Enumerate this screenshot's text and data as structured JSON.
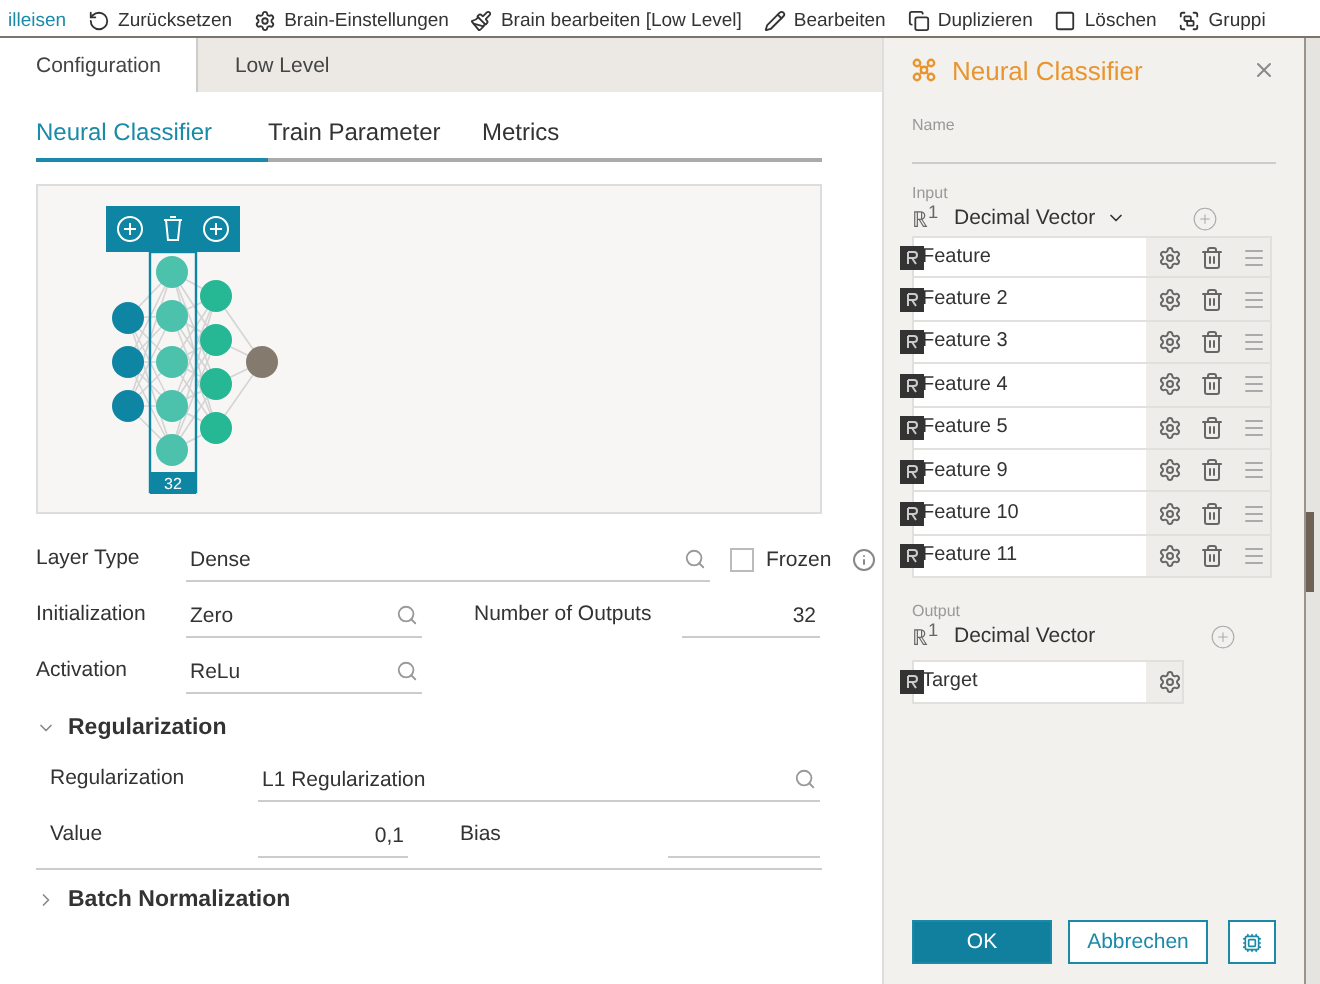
{
  "toolbar": [
    {
      "kind": "link",
      "label": "illeisen"
    },
    {
      "kind": "undo",
      "label": "Zurücksetzen"
    },
    {
      "kind": "settings",
      "label": "Brain-Einstellungen"
    },
    {
      "kind": "brush",
      "label": "Brain bearbeiten [Low Level]"
    },
    {
      "kind": "pen",
      "label": "Bearbeiten"
    },
    {
      "kind": "copy",
      "label": "Duplizieren"
    },
    {
      "kind": "trash",
      "label": "Löschen"
    },
    {
      "kind": "group",
      "label": "Gruppi"
    }
  ],
  "tabs": [
    {
      "label": "Configuration",
      "selected": true
    },
    {
      "label": "Low Level",
      "selected": false
    }
  ],
  "subtabs": [
    {
      "label": "Neural Classifier",
      "selected": true
    },
    {
      "label": "Train Parameter",
      "selected": false
    },
    {
      "label": "Metrics",
      "selected": false
    }
  ],
  "network": {
    "layer_size": "32"
  },
  "layer_type": {
    "label": "Layer Type",
    "value": "Dense"
  },
  "frozen": {
    "label": "Frozen",
    "checked": false
  },
  "initialization": {
    "label": "Initialization",
    "value": "Zero"
  },
  "number_of_outputs": {
    "label": "Number of Outputs",
    "value": "32"
  },
  "activation": {
    "label": "Activation",
    "value": "ReLu"
  },
  "regularization": {
    "title": "Regularization",
    "expanded": true,
    "type": {
      "label": "Regularization",
      "value": "L1 Regularization"
    },
    "value": {
      "label": "Value",
      "value": "0,1"
    },
    "bias": {
      "label": "Bias"
    }
  },
  "batch_normalization": {
    "title": "Batch Normalization",
    "expanded": false
  },
  "panel": {
    "title": "Neural Classifier",
    "name_label": "Name",
    "input": {
      "label": "Input",
      "type_symbol": "ℝ$^{1}$",
      "type": "Decimal Vector",
      "features": [
        "Feature",
        "Feature 2",
        "Feature 3",
        "Feature 4",
        "Feature 5",
        "Feature 9",
        "Feature 10",
        "Feature 11"
      ]
    },
    "output": {
      "label": "Output",
      "type_symbol": "ℝ$^{1}$",
      "type": "Decimal Vector",
      "features": [
        "Target"
      ]
    },
    "buttons": [
      {
        "kind": "primary",
        "label": "OK"
      },
      {
        "kind": "secondary",
        "label": "Abbrechen"
      },
      {
        "kind": "icon"
      }
    ]
  }
}
